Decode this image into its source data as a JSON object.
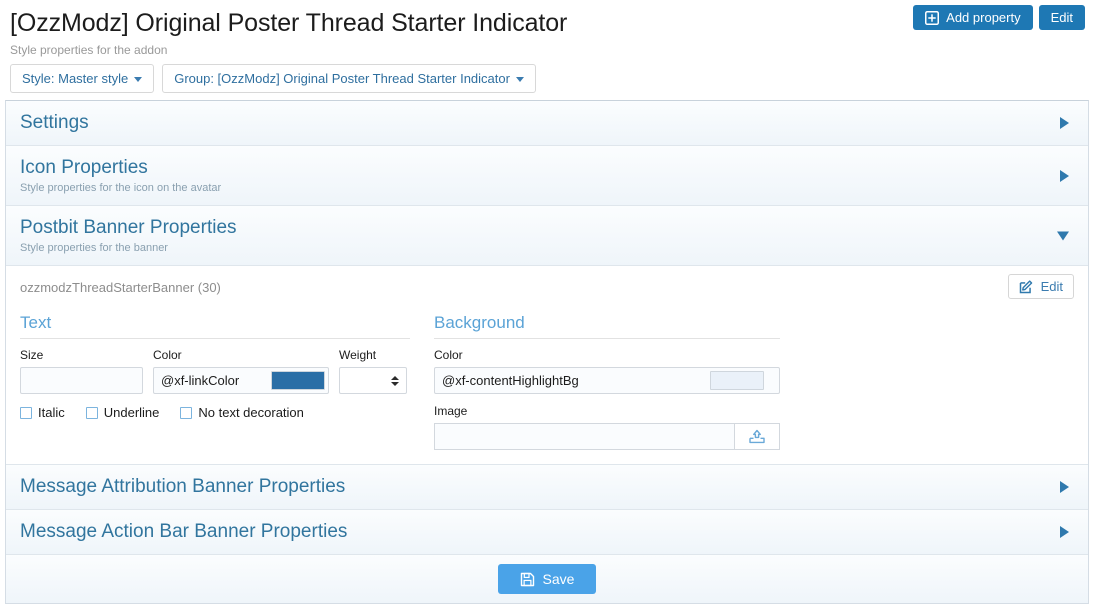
{
  "header": {
    "title": "[OzzModz] Original Poster Thread Starter Indicator",
    "subtitle": "Style properties for the addon",
    "add_property_label": "Add property",
    "edit_label": "Edit"
  },
  "selectors": {
    "style": "Style: Master style",
    "group": "Group: [OzzModz] Original Poster Thread Starter Indicator"
  },
  "sections": [
    {
      "title": "Settings",
      "desc": "",
      "expanded": false
    },
    {
      "title": "Icon Properties",
      "desc": "Style properties for the icon on the avatar",
      "expanded": false
    },
    {
      "title": "Postbit Banner Properties",
      "desc": "Style properties for the banner",
      "expanded": true
    },
    {
      "title": "Message Attribution Banner Properties",
      "desc": "",
      "expanded": false
    },
    {
      "title": "Message Action Bar Banner Properties",
      "desc": "",
      "expanded": false
    }
  ],
  "property": {
    "name": "ozzmodzThreadStarterBanner (30)",
    "edit_label": "Edit",
    "text_group": {
      "heading": "Text",
      "size_label": "Size",
      "size_value": "",
      "color_label": "Color",
      "color_value": "@xf-linkColor",
      "color_swatch": "#2a6ea6",
      "weight_label": "Weight",
      "weight_value": "",
      "checkboxes": [
        {
          "label": "Italic",
          "checked": false
        },
        {
          "label": "Underline",
          "checked": false
        },
        {
          "label": "No text decoration",
          "checked": false
        }
      ]
    },
    "background_group": {
      "heading": "Background",
      "color_label": "Color",
      "color_value": "@xf-contentHighlightBg",
      "color_swatch": "#eaf1f9",
      "image_label": "Image",
      "image_value": ""
    }
  },
  "footer": {
    "save_label": "Save"
  },
  "colors": {
    "primary_blue": "#1e78b4",
    "save_blue": "#4aa3e8",
    "section_heading": "#31759e",
    "group_heading": "#5ba3d6"
  }
}
